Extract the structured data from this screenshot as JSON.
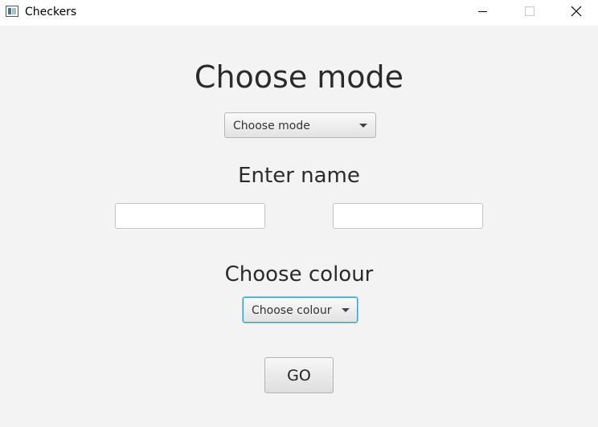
{
  "window": {
    "title": "Checkers"
  },
  "main": {
    "mode_heading": "Choose mode",
    "mode_select": {
      "selected": "Choose mode"
    },
    "name_heading": "Enter name",
    "name_inputs": [
      {
        "value": "",
        "placeholder": ""
      },
      {
        "value": "",
        "placeholder": ""
      }
    ],
    "colour_heading": "Choose colour",
    "colour_select": {
      "selected": "Choose colour"
    },
    "go_label": "GO"
  },
  "colors": {
    "background": "#f3f3f3",
    "focus_border": "#2a9fd6",
    "heading_text": "#2b2b2b"
  },
  "icons": [
    "app-icon",
    "minimize-icon",
    "maximize-icon",
    "close-icon",
    "chevron-down-icon"
  ]
}
